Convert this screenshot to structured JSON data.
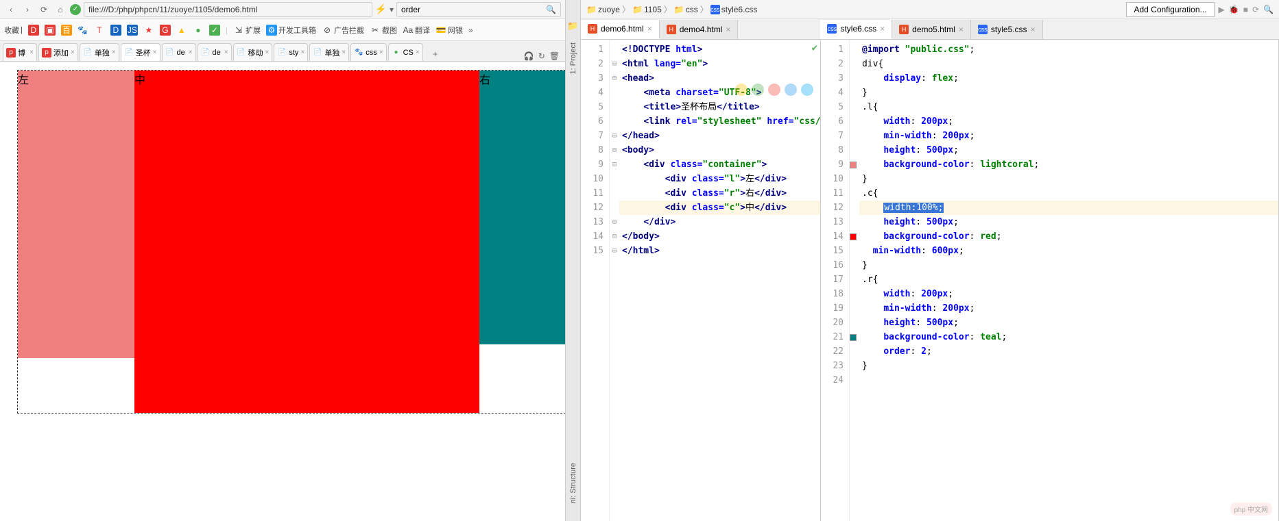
{
  "browser": {
    "url": "file:///D:/php/phpcn/11/zuoye/1105/demo6.html",
    "search_value": "order",
    "bookmarks": [
      {
        "icon": "D",
        "cls": "ic-red",
        "label": ""
      },
      {
        "icon": "⬚",
        "cls": "ic-red",
        "label": ""
      },
      {
        "icon": "百",
        "cls": "ic-orange",
        "label": ""
      },
      {
        "icon": "🐾",
        "cls": "ic-paw",
        "label": ""
      },
      {
        "icon": "T",
        "cls": "ic-blue",
        "label": ""
      },
      {
        "icon": "D",
        "cls": "ic-dblue",
        "label": ""
      },
      {
        "icon": "JS",
        "cls": "ic-yellow",
        "label": ""
      },
      {
        "icon": "★",
        "cls": "ic-red",
        "label": ""
      },
      {
        "icon": "G",
        "cls": "ic-red",
        "label": ""
      },
      {
        "icon": "▲",
        "cls": "",
        "label": ""
      },
      {
        "icon": "●",
        "cls": "",
        "label": ""
      },
      {
        "icon": "●",
        "cls": "ic-green",
        "label": ""
      },
      {
        "icon": "|",
        "cls": "",
        "label": ""
      },
      {
        "icon": "↙",
        "cls": "",
        "label": "扩展"
      },
      {
        "icon": "🔧",
        "cls": "ic-blue",
        "label": "开发工具箱"
      },
      {
        "icon": "⊘",
        "cls": "",
        "label": "广告拦截"
      },
      {
        "icon": "✂",
        "cls": "",
        "label": "截图"
      },
      {
        "icon": "Aа",
        "cls": "",
        "label": "翻译"
      },
      {
        "icon": "💳",
        "cls": "",
        "label": "网银"
      }
    ],
    "tabs": [
      {
        "icon": "php",
        "cls": "ic-red",
        "label": "博",
        "active": false
      },
      {
        "icon": "php",
        "cls": "ic-red",
        "label": "添加",
        "active": false
      },
      {
        "icon": "",
        "cls": "",
        "label": "单独",
        "active": false
      },
      {
        "icon": "",
        "cls": "",
        "label": "圣杯",
        "active": true
      },
      {
        "icon": "",
        "cls": "",
        "label": "de",
        "active": false
      },
      {
        "icon": "",
        "cls": "",
        "label": "de",
        "active": false
      },
      {
        "icon": "",
        "cls": "",
        "label": "移动",
        "active": false
      },
      {
        "icon": "",
        "cls": "",
        "label": "sty",
        "active": false
      },
      {
        "icon": "",
        "cls": "",
        "label": "单独",
        "active": false
      },
      {
        "icon": "🐾",
        "cls": "ic-paw",
        "label": "css",
        "active": false
      },
      {
        "icon": "●",
        "cls": "ic-green",
        "label": "CS",
        "active": false
      }
    ],
    "page": {
      "left": "左",
      "center": "中",
      "right": "右"
    }
  },
  "ide": {
    "breadcrumb": [
      "zuoye",
      "1105",
      "css",
      "style6.css"
    ],
    "config_button": "Add Configuration...",
    "left_tabs": [
      {
        "name": "demo6.html",
        "type": "html",
        "active": true
      },
      {
        "name": "demo4.html",
        "type": "html",
        "active": false
      }
    ],
    "right_tabs": [
      {
        "name": "style6.css",
        "type": "css",
        "active": true
      },
      {
        "name": "demo5.html",
        "type": "html",
        "active": false
      },
      {
        "name": "style5.css",
        "type": "css",
        "active": false
      }
    ],
    "html_lines": 15,
    "css_lines": 24,
    "selected_css": "width:100%;",
    "html_code": {
      "l1_doctype": "<!DOCTYPE ",
      "l1_html": "html",
      "l1_end": ">",
      "l2_open": "<html ",
      "l2_attr": "lang=",
      "l2_val": "\"en\"",
      "l2_end": ">",
      "l3": "<head>",
      "l4_open": "<meta ",
      "l4_attr": "charset=",
      "l4_val": "\"UTF-8\"",
      "l4_end": ">",
      "l5_open": "<title>",
      "l5_text": "圣杯布局",
      "l5_close": "</title>",
      "l6_open": "<link ",
      "l6_a1": "rel=",
      "l6_v1": "\"stylesheet\" ",
      "l6_a2": "href=",
      "l6_v2": "\"css/",
      "l7": "</head>",
      "l8": "<body>",
      "l9_open": "<div ",
      "l9_attr": "class=",
      "l9_val": "\"container\"",
      "l9_end": ">",
      "l10_open": "<div ",
      "l10_attr": "class=",
      "l10_val": "\"l\"",
      "l10_end": ">",
      "l10_text": "左",
      "l10_close": "</div>",
      "l11_open": "<div ",
      "l11_attr": "class=",
      "l11_val": "\"r\"",
      "l11_end": ">",
      "l11_text": "右",
      "l11_close": "</div>",
      "l12_open": "<div ",
      "l12_attr": "class=",
      "l12_val": "\"c\"",
      "l12_end": ">",
      "l12_text": "中",
      "l12_close": "</div>",
      "l13": "</div>",
      "l14": "</body>",
      "l15": "</html>"
    },
    "css_code": {
      "l1_imp": "@import ",
      "l1_val": "\"public.css\"",
      "l1_end": ";",
      "l2": "div{",
      "l3_p": "display",
      "l3_v": "flex",
      "l4": "}",
      "l5": ".l{",
      "l6_p": "width",
      "l6_v": "200px",
      "l7_p": "min-width",
      "l7_v": "200px",
      "l8_p": "height",
      "l8_v": "500px",
      "l9_p": "background-color",
      "l9_v": "lightcoral",
      "l10": "}",
      "l11": ".c{",
      "l13_p": "height",
      "l13_v": "500px",
      "l14_p": "background-color",
      "l14_v": "red",
      "l15_p": "min-width",
      "l15_v": "600px",
      "l16": "}",
      "l17": ".r{",
      "l18_p": "width",
      "l18_v": "200px",
      "l19_p": "min-width",
      "l19_v": "200px",
      "l20_p": "height",
      "l20_v": "500px",
      "l21_p": "background-color",
      "l21_v": "teal",
      "l22_p": "order",
      "l22_v": "2",
      "l23": "}"
    }
  },
  "project_label": "1: Project",
  "structure_label": "ni: Structure",
  "bookmark_prefix": "收藏"
}
